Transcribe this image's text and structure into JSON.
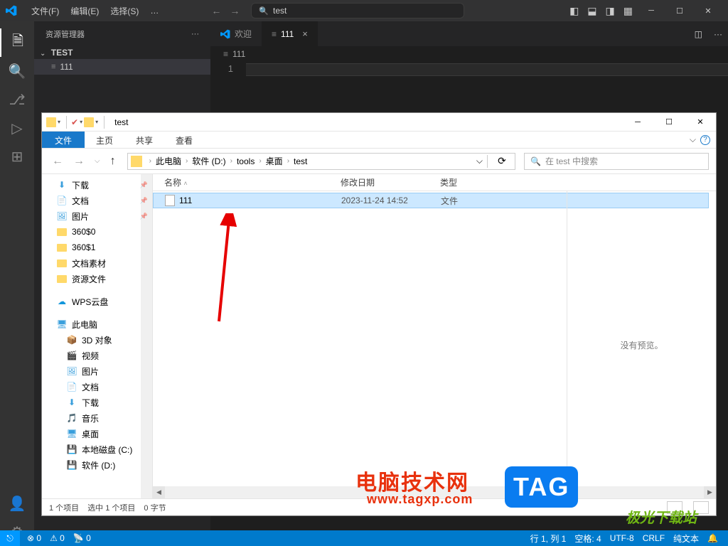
{
  "vscode": {
    "menu": {
      "file": "文件(F)",
      "edit": "编辑(E)",
      "select": "选择(S)",
      "more": "…"
    },
    "nav": {
      "back": "←",
      "forward": "→"
    },
    "search": {
      "icon": "🔍",
      "text": "test"
    },
    "sidebar": {
      "title": "资源管理器",
      "more": "···",
      "root": "TEST",
      "file": "111"
    },
    "tabs": {
      "welcome": "欢迎",
      "active": "111",
      "close": "×"
    },
    "breadcrumb": {
      "file": "111"
    },
    "gutter": "1",
    "status": {
      "launch": "⎋",
      "errors": "⊗ 0",
      "warnings": "⚠ 0",
      "ports": "📡 0",
      "line_col": "行 1, 列 1",
      "spaces": "空格: 4",
      "encoding": "UTF-8",
      "eol": "CRLF",
      "lang": "纯文本",
      "notif": "🔔"
    }
  },
  "explorer": {
    "title": "test",
    "ribbon": {
      "file": "文件",
      "home": "主页",
      "share": "共享",
      "view": "查看",
      "expand": "⌵",
      "help": "?"
    },
    "address": {
      "segs": [
        "此电脑",
        "软件 (D:)",
        "tools",
        "桌面",
        "test"
      ],
      "search_placeholder": "在 test 中搜索",
      "dropdown": "⌵",
      "refresh": "⟳"
    },
    "nav": [
      {
        "icon": "⬇",
        "color": "#3a9fdc",
        "label": "下载",
        "pin": true
      },
      {
        "icon": "📄",
        "color": "#3a9fdc",
        "label": "文档",
        "pin": true
      },
      {
        "icon": "🖼",
        "color": "#3a9fdc",
        "label": "图片",
        "pin": true
      },
      {
        "icon": "folder",
        "label": "360$0"
      },
      {
        "icon": "folder",
        "label": "360$1"
      },
      {
        "icon": "folder",
        "label": "文档素材"
      },
      {
        "icon": "folder",
        "label": "资源文件"
      },
      {
        "icon": "☁",
        "color": "#1296db",
        "label": "WPS云盘",
        "gap": true
      },
      {
        "icon": "🖥",
        "color": "#3a9fdc",
        "label": "此电脑",
        "gap": true
      },
      {
        "icon": "📦",
        "color": "#25c8b7",
        "label": "3D 对象",
        "indent": true
      },
      {
        "icon": "🎬",
        "color": "#3a9fdc",
        "label": "视频",
        "indent": true
      },
      {
        "icon": "🖼",
        "color": "#3a9fdc",
        "label": "图片",
        "indent": true
      },
      {
        "icon": "📄",
        "color": "#3a9fdc",
        "label": "文档",
        "indent": true
      },
      {
        "icon": "⬇",
        "color": "#3a9fdc",
        "label": "下载",
        "indent": true
      },
      {
        "icon": "🎵",
        "color": "#3a9fdc",
        "label": "音乐",
        "indent": true
      },
      {
        "icon": "🖥",
        "color": "#3a9fdc",
        "label": "桌面",
        "indent": true
      },
      {
        "icon": "💾",
        "color": "#888",
        "label": "本地磁盘 (C:)",
        "indent": true
      },
      {
        "icon": "💾",
        "color": "#888",
        "label": "软件 (D:)",
        "indent": true
      }
    ],
    "columns": {
      "name": "名称",
      "date": "修改日期",
      "type": "类型"
    },
    "file": {
      "name": "111",
      "date": "2023-11-24 14:52",
      "type": "文件"
    },
    "preview": "没有预览。",
    "status": {
      "count": "1 个项目",
      "selected": "选中 1 个项目",
      "size": "0 字节"
    }
  },
  "wm": {
    "brand": "电脑技术网",
    "url": "www.tagxp.com",
    "tag": "TAG",
    "site": "极光下载站"
  }
}
